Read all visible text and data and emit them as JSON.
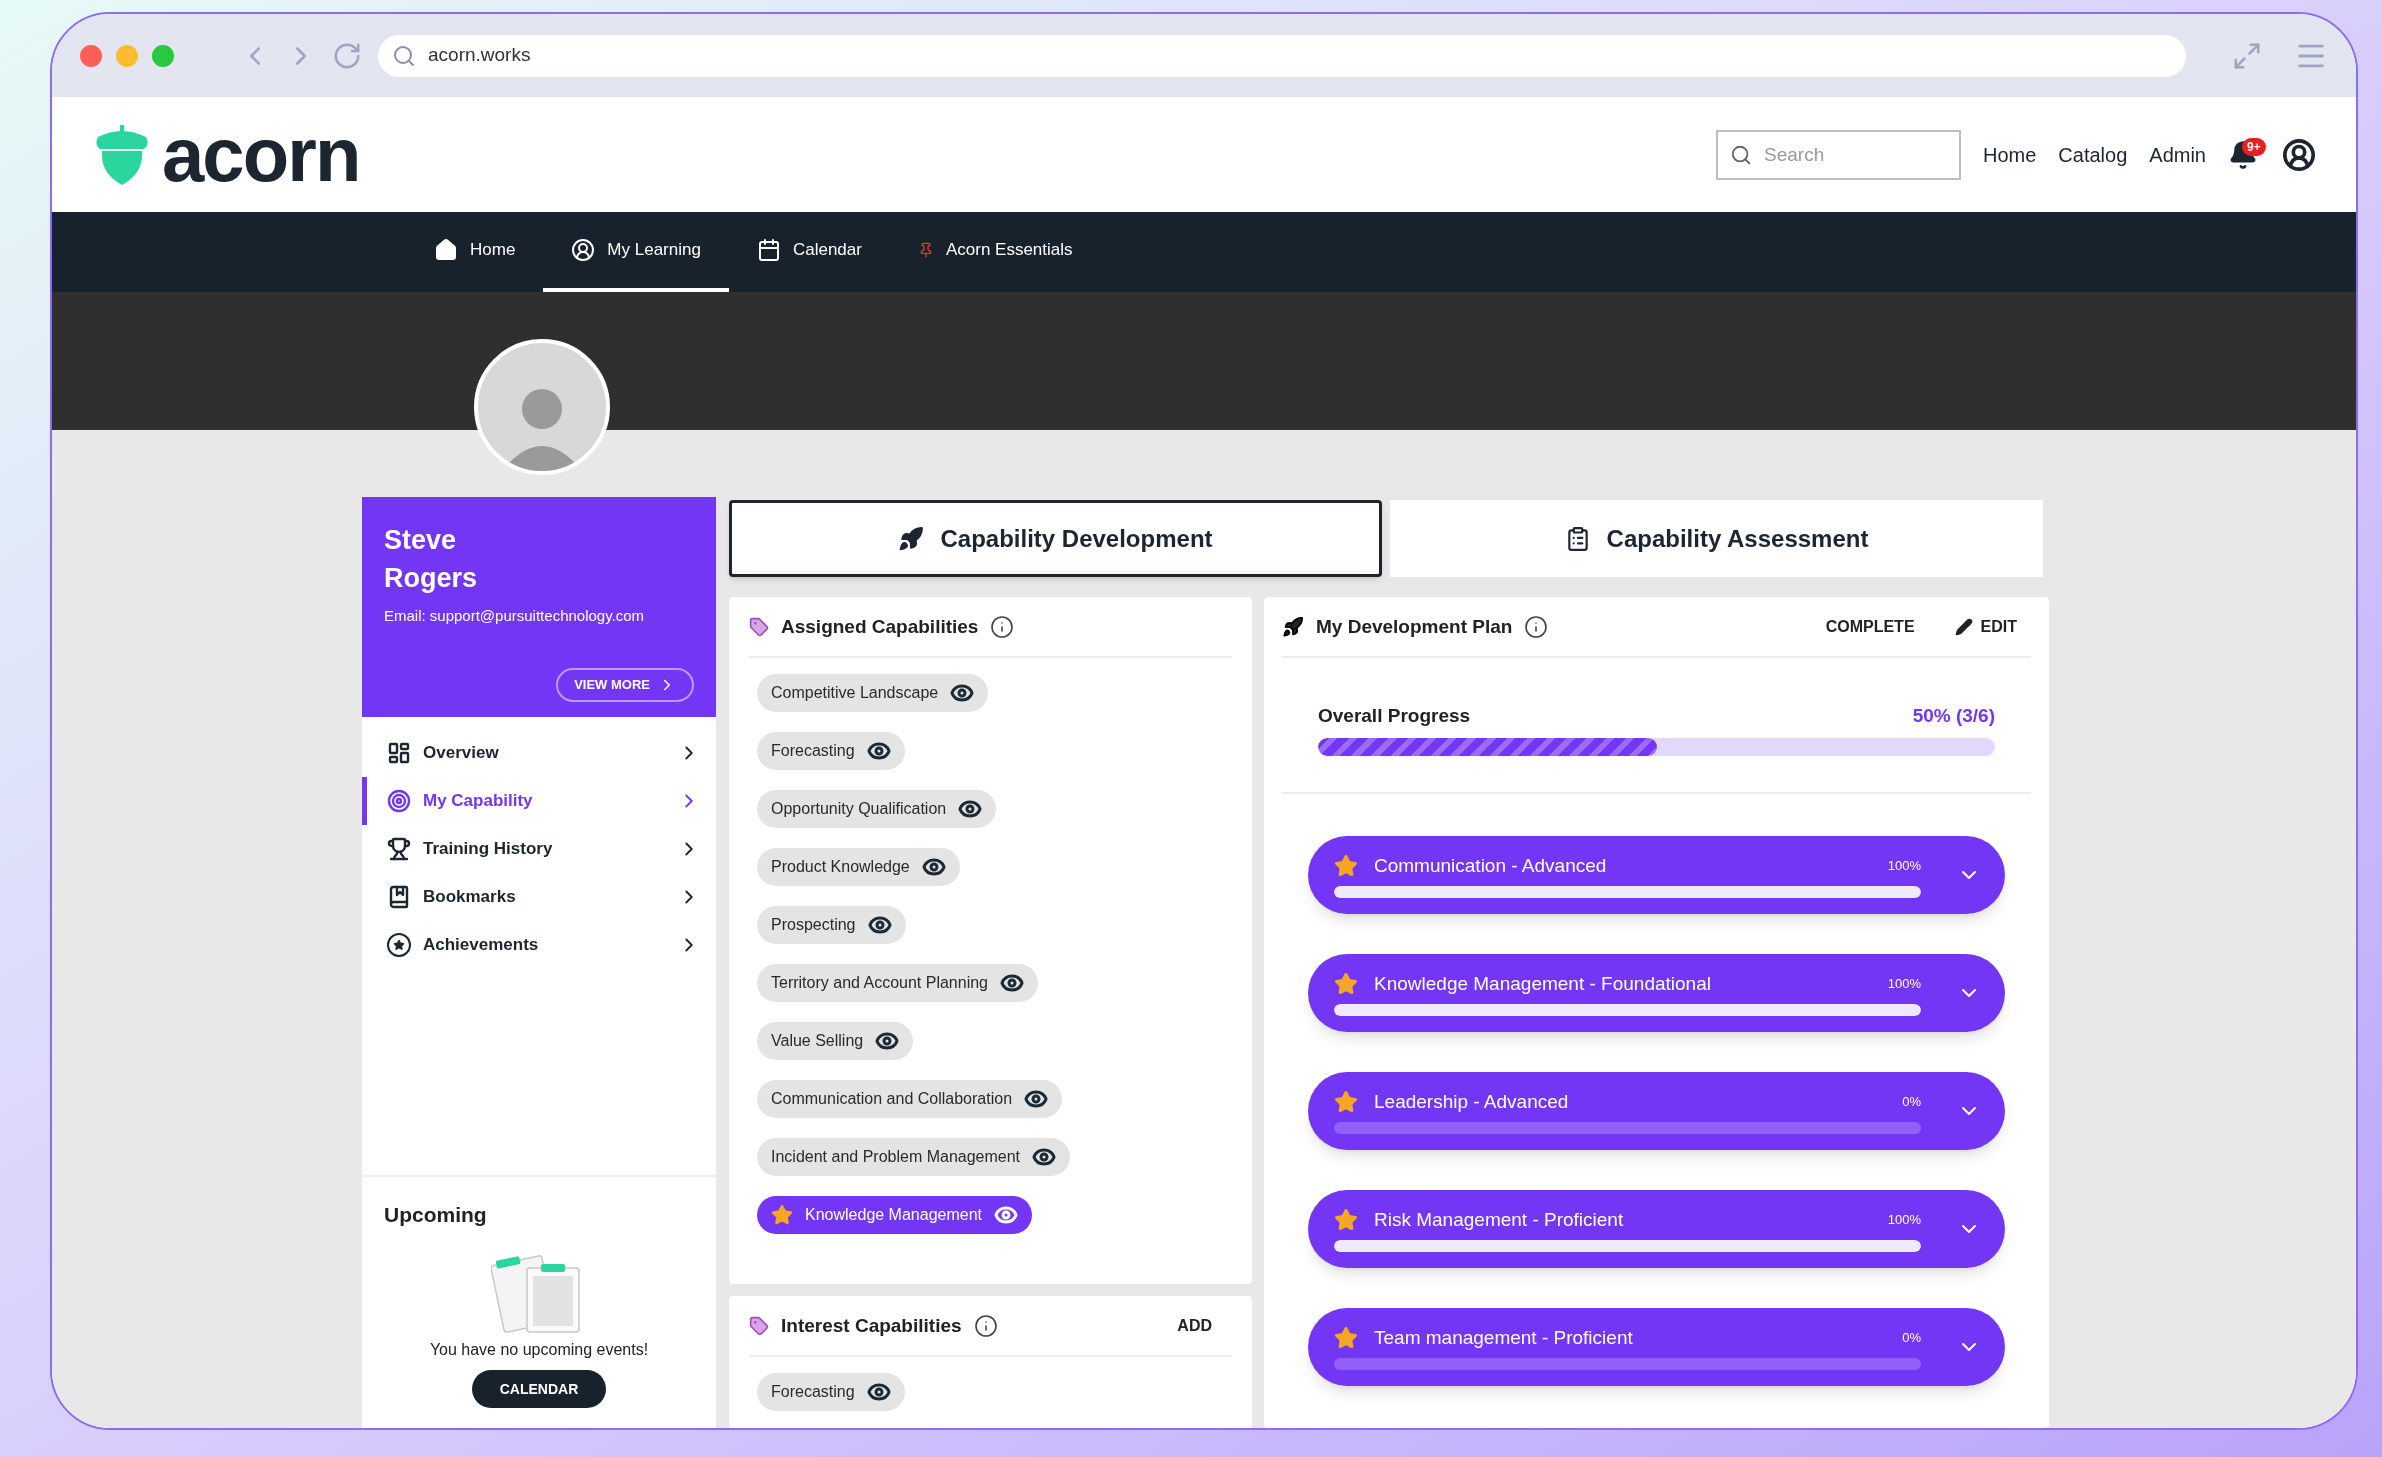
{
  "browser": {
    "url": "acorn.works"
  },
  "header": {
    "logo": "acorn",
    "search_placeholder": "Search",
    "links": [
      "Home",
      "Catalog",
      "Admin"
    ],
    "notification_badge": "9+"
  },
  "nav": [
    {
      "label": "Home",
      "selected": false
    },
    {
      "label": "My Learning",
      "selected": true
    },
    {
      "label": "Calendar",
      "selected": false
    },
    {
      "label": "Acorn Essentials",
      "selected": false
    }
  ],
  "profile": {
    "first_name": "Steve",
    "last_name": "Rogers",
    "email": "Email: support@pursuittechnology.com",
    "button": "VIEW MORE"
  },
  "menu": [
    {
      "label": "Overview",
      "selected": false
    },
    {
      "label": "My Capability",
      "selected": true
    },
    {
      "label": "Training History",
      "selected": false
    },
    {
      "label": "Bookmarks",
      "selected": false
    },
    {
      "label": "Achievements",
      "selected": false
    }
  ],
  "upcoming": {
    "title": "Upcoming",
    "message": "You have no upcoming events!",
    "button": "CALENDAR"
  },
  "tabs": [
    {
      "label": "Capability Development",
      "selected": true
    },
    {
      "label": "Capability Assessment",
      "selected": false
    }
  ],
  "assigned": {
    "title": "Assigned Capabilities",
    "items": [
      {
        "label": "Competitive Landscape",
        "selected": false
      },
      {
        "label": "Forecasting",
        "selected": false
      },
      {
        "label": "Opportunity Qualification",
        "selected": false
      },
      {
        "label": "Product Knowledge",
        "selected": false
      },
      {
        "label": "Prospecting",
        "selected": false
      },
      {
        "label": "Territory and Account Planning",
        "selected": false
      },
      {
        "label": "Value Selling",
        "selected": false
      },
      {
        "label": "Communication and Collaboration",
        "selected": false
      },
      {
        "label": "Incident and Problem Management",
        "selected": false
      },
      {
        "label": "Knowledge Management",
        "selected": true
      }
    ]
  },
  "interest": {
    "title": "Interest Capabilities",
    "action": "ADD",
    "items": [
      {
        "label": "Forecasting",
        "selected": false
      }
    ]
  },
  "plan": {
    "title": "My Development Plan",
    "complete": "COMPLETE",
    "edit": "EDIT",
    "progress": {
      "label": "Overall Progress",
      "reading": "50% (3/6)",
      "level": 0.5
    },
    "goals": [
      {
        "label": "Communication - Advanced",
        "reading": "100%",
        "level": 1
      },
      {
        "label": "Knowledge Management - Foundational",
        "reading": "100%",
        "level": 1
      },
      {
        "label": "Leadership - Advanced",
        "reading": "0%",
        "level": 0
      },
      {
        "label": "Risk Management - Proficient",
        "reading": "100%",
        "level": 1
      },
      {
        "label": "Team management - Proficient",
        "reading": "0%",
        "level": 0
      }
    ]
  }
}
